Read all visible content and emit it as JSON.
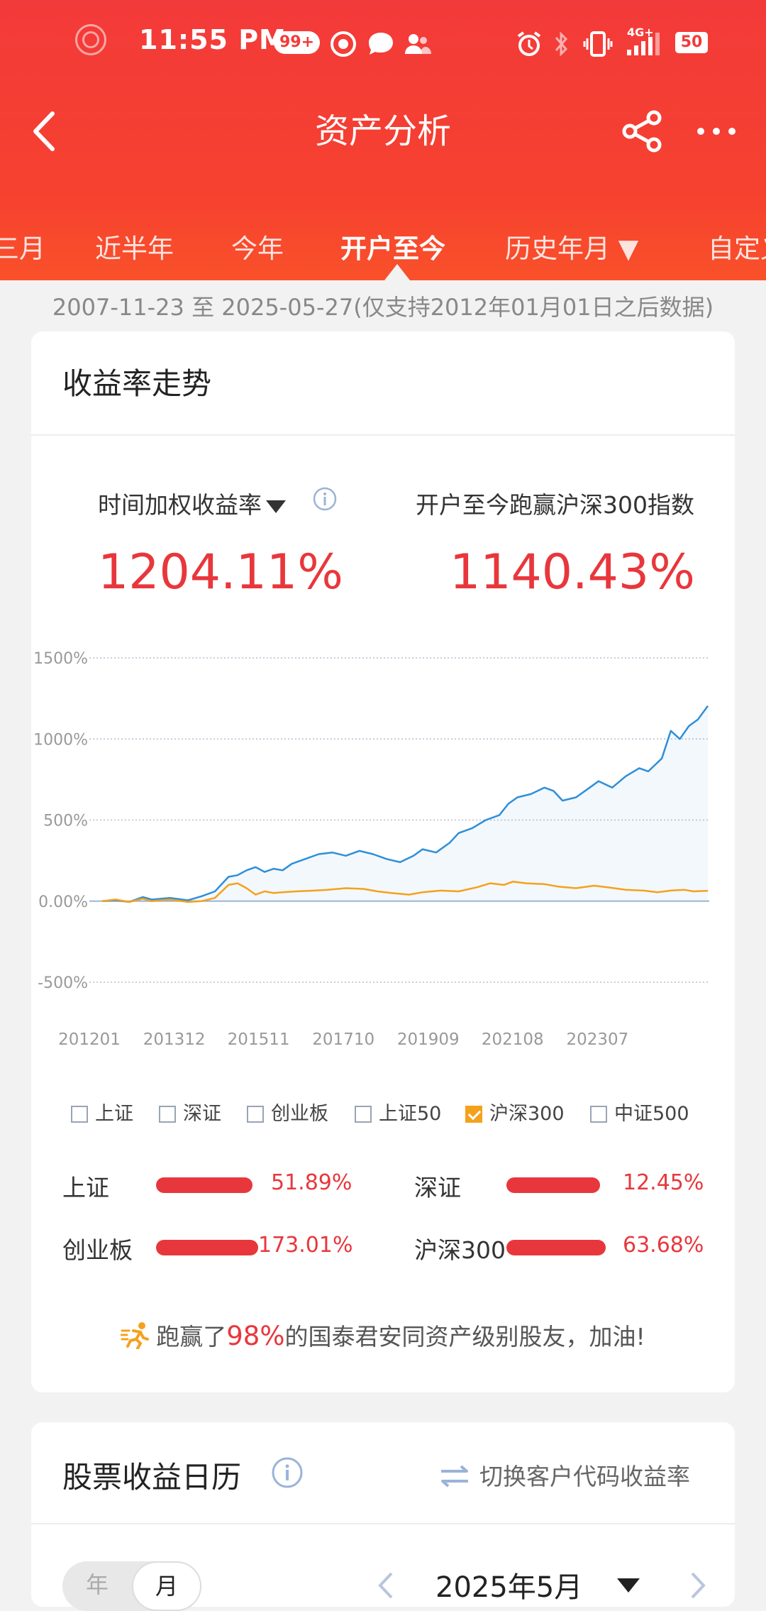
{
  "status_bar": {
    "time": "11:55 PM",
    "notif_badge": "99+",
    "network": "4G+",
    "battery": "50"
  },
  "nav": {
    "title": "资产分析"
  },
  "tabs": [
    {
      "label": "三月",
      "active": false
    },
    {
      "label": "近半年",
      "active": false
    },
    {
      "label": "今年",
      "active": false
    },
    {
      "label": "开户至今",
      "active": true
    },
    {
      "label": "历史年月 ▼",
      "active": false
    },
    {
      "label": "自定义",
      "active": false
    }
  ],
  "date_range": "2007-11-23 至 2025-05-27(仅支持2012年01月01日之后数据)",
  "returns_card": {
    "title": "收益率走势",
    "metric_left_label": "时间加权收益率",
    "metric_left_value": "1204.11%",
    "metric_right_label": "开户至今跑赢沪深300指数",
    "metric_right_value": "1140.43%"
  },
  "chart_data": {
    "type": "line",
    "y_ticks": [
      "1500%",
      "1000%",
      "500%",
      "0.00%",
      "-500%"
    ],
    "x_ticks": [
      "201201",
      "201312",
      "201511",
      "201710",
      "201909",
      "202108",
      "202307"
    ],
    "ylim": [
      -500,
      1500
    ],
    "x_range": [
      2012.0,
      2025.42
    ],
    "grid": true,
    "colors": {
      "series1": "#2f8fd8",
      "series2": "#f5a11c",
      "zero_line": "#9db6d6"
    },
    "series": [
      {
        "x": [
          2012.0,
          2012.3,
          2012.6,
          2012.9,
          2013.1,
          2013.5,
          2013.9,
          2014.2,
          2014.5,
          2014.8,
          2015.0,
          2015.2,
          2015.4,
          2015.6,
          2015.8,
          2016.0,
          2016.2,
          2016.5,
          2016.8,
          2017.1,
          2017.4,
          2017.7,
          2018.0,
          2018.3,
          2018.6,
          2018.9,
          2019.1,
          2019.4,
          2019.7,
          2019.9,
          2020.2,
          2020.5,
          2020.8,
          2021.0,
          2021.2,
          2021.5,
          2021.8,
          2022.0,
          2022.2,
          2022.5,
          2022.8,
          2023.0,
          2023.3,
          2023.6,
          2023.9,
          2024.1,
          2024.4,
          2024.6,
          2024.8,
          2025.0,
          2025.2,
          2025.42
        ],
        "values": [
          0,
          5,
          -5,
          25,
          10,
          20,
          5,
          30,
          60,
          150,
          160,
          190,
          210,
          180,
          200,
          190,
          230,
          260,
          290,
          300,
          280,
          310,
          290,
          260,
          240,
          280,
          320,
          300,
          360,
          420,
          450,
          500,
          530,
          600,
          640,
          660,
          700,
          680,
          620,
          640,
          700,
          740,
          700,
          770,
          820,
          800,
          880,
          1050,
          1000,
          1080,
          1120,
          1204
        ]
      },
      {
        "x": [
          2012.0,
          2012.3,
          2012.6,
          2012.9,
          2013.1,
          2013.5,
          2013.9,
          2014.2,
          2014.5,
          2014.8,
          2015.0,
          2015.2,
          2015.4,
          2015.6,
          2015.8,
          2016.0,
          2016.3,
          2016.7,
          2017.0,
          2017.4,
          2017.8,
          2018.1,
          2018.4,
          2018.8,
          2019.1,
          2019.5,
          2019.9,
          2020.3,
          2020.6,
          2020.9,
          2021.1,
          2021.4,
          2021.8,
          2022.1,
          2022.5,
          2022.9,
          2023.2,
          2023.6,
          2024.0,
          2024.3,
          2024.6,
          2024.9,
          2025.1,
          2025.42
        ],
        "values": [
          0,
          10,
          -5,
          15,
          0,
          10,
          -5,
          0,
          20,
          100,
          110,
          80,
          40,
          60,
          50,
          55,
          60,
          65,
          70,
          80,
          75,
          60,
          50,
          40,
          55,
          65,
          60,
          85,
          110,
          100,
          120,
          110,
          105,
          90,
          80,
          95,
          85,
          70,
          65,
          55,
          65,
          70,
          60,
          64
        ]
      }
    ]
  },
  "legend": [
    {
      "label": "上证",
      "checked": false
    },
    {
      "label": "深证",
      "checked": false
    },
    {
      "label": "创业板",
      "checked": false
    },
    {
      "label": "上证50",
      "checked": false
    },
    {
      "label": "沪深300",
      "checked": true
    },
    {
      "label": "中证500",
      "checked": false
    }
  ],
  "comparisons": [
    {
      "label": "上证",
      "value": "51.89%",
      "bar_fraction": 0.95
    },
    {
      "label": "深证",
      "value": "12.45%",
      "bar_fraction": 0.92
    },
    {
      "label": "创业板",
      "value": "173.01%",
      "bar_fraction": 1.0
    },
    {
      "label": "沪深300",
      "value": "63.68%",
      "bar_fraction": 0.97
    }
  ],
  "beat": {
    "prefix": "跑赢了",
    "pct": "98%",
    "suffix": "的国泰君安同资产级别股友，加油!"
  },
  "calendar_card": {
    "title": "股票收益日历",
    "switch_label": "切换客户代码收益率",
    "seg_year": "年",
    "seg_month": "月",
    "month": "2025年5月"
  }
}
